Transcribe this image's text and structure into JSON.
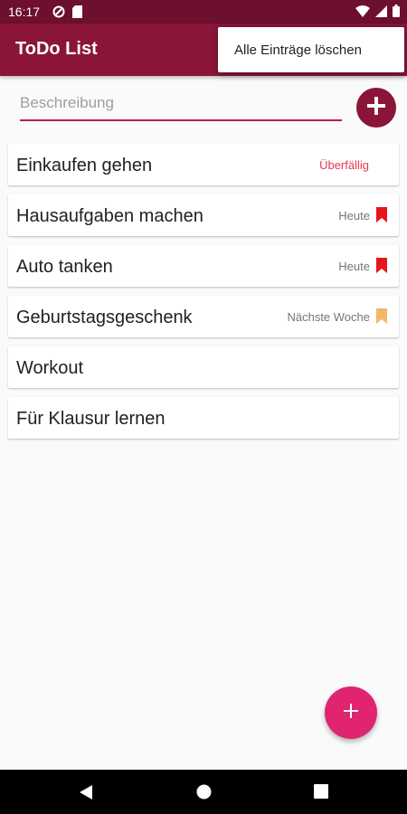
{
  "status_bar": {
    "time": "16:17"
  },
  "app_bar": {
    "title": "ToDo List"
  },
  "overflow_menu": {
    "clear_all_label": "Alle Einträge löschen"
  },
  "input": {
    "placeholder": "Beschreibung",
    "value": ""
  },
  "tasks": [
    {
      "title": "Einkaufen gehen",
      "due": "Überfällig",
      "flag_color": ""
    },
    {
      "title": "Hausaufgaben machen",
      "due": "Heute",
      "flag_color": "#e8141c"
    },
    {
      "title": "Auto tanken",
      "due": "Heute",
      "flag_color": "#e8141c"
    },
    {
      "title": "Geburtstagsgeschenk",
      "due": "Nächste Woche",
      "flag_color": "#f2b866"
    },
    {
      "title": "Workout",
      "due": "",
      "flag_color": ""
    },
    {
      "title": "Für Klausur lernen",
      "due": "",
      "flag_color": ""
    }
  ],
  "colors": {
    "status_bar": "#6d0f2f",
    "app_bar": "#8a1538",
    "accent": "#c2185b",
    "fab": "#e0246f",
    "overdue": "#e53950"
  }
}
